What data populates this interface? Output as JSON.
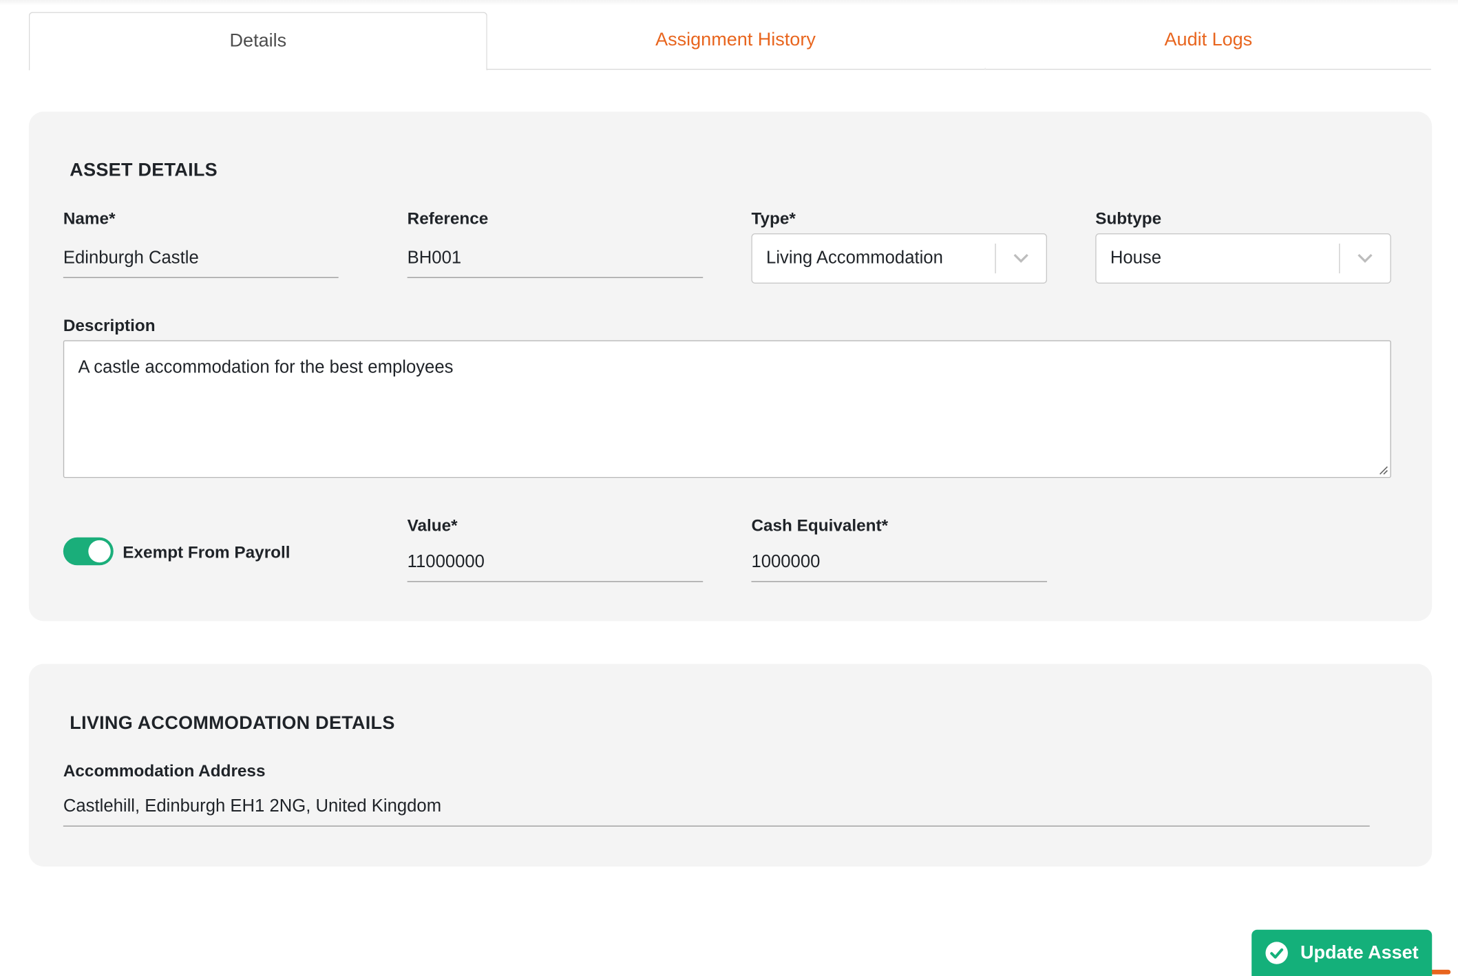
{
  "tabs": [
    {
      "label": "Details",
      "active": true
    },
    {
      "label": "Assignment History",
      "active": false
    },
    {
      "label": "Audit Logs",
      "active": false
    }
  ],
  "asset_details": {
    "title": "ASSET DETAILS",
    "name_label": "Name*",
    "name_value": "Edinburgh Castle",
    "reference_label": "Reference",
    "reference_value": "BH001",
    "type_label": "Type*",
    "type_value": "Living Accommodation",
    "subtype_label": "Subtype",
    "subtype_value": "House",
    "description_label": "Description",
    "description_value": "A castle accommodation for the best employees",
    "exempt_label": "Exempt From Payroll",
    "exempt_on": true,
    "value_label": "Value*",
    "value_value": "11000000",
    "cash_label": "Cash Equivalent*",
    "cash_value": "1000000"
  },
  "living_details": {
    "title": "LIVING ACCOMMODATION DETAILS",
    "address_label": "Accommodation Address",
    "address_value": "Castlehill, Edinburgh EH1 2NG, United Kingdom"
  },
  "actions": {
    "update_label": "Update Asset"
  },
  "colors": {
    "accent_orange": "#e8651e",
    "success_green": "#14b07a",
    "card_bg": "#f4f4f4"
  }
}
